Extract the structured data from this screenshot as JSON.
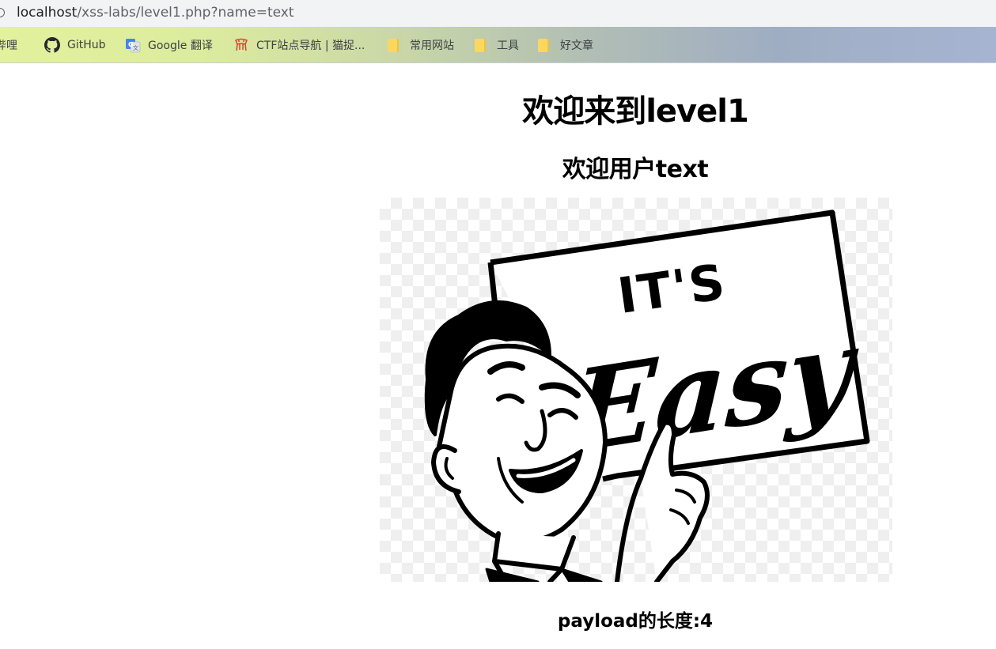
{
  "browser": {
    "url_host": "localhost",
    "url_path": "/xss-labs/level1.php?name=text",
    "bookmarks": [
      {
        "label": "哔哩哔哩",
        "icon": "bilibili-icon"
      },
      {
        "label": "GitHub",
        "icon": "github-icon"
      },
      {
        "label": "Google 翻译",
        "icon": "google-translate-icon"
      },
      {
        "label": "CTF站点导航 | 猫捉...",
        "icon": "ctf-nav-icon"
      },
      {
        "label": "常用网站",
        "icon": "folder-icon"
      },
      {
        "label": "工具",
        "icon": "folder-icon"
      },
      {
        "label": "好文章",
        "icon": "folder-icon"
      }
    ]
  },
  "page": {
    "title": "欢迎来到level1",
    "welcome": "欢迎用户text",
    "image_sign_text_1": "IT'S",
    "image_sign_text_2": "Easy",
    "payload_length": "payload的长度:4"
  }
}
